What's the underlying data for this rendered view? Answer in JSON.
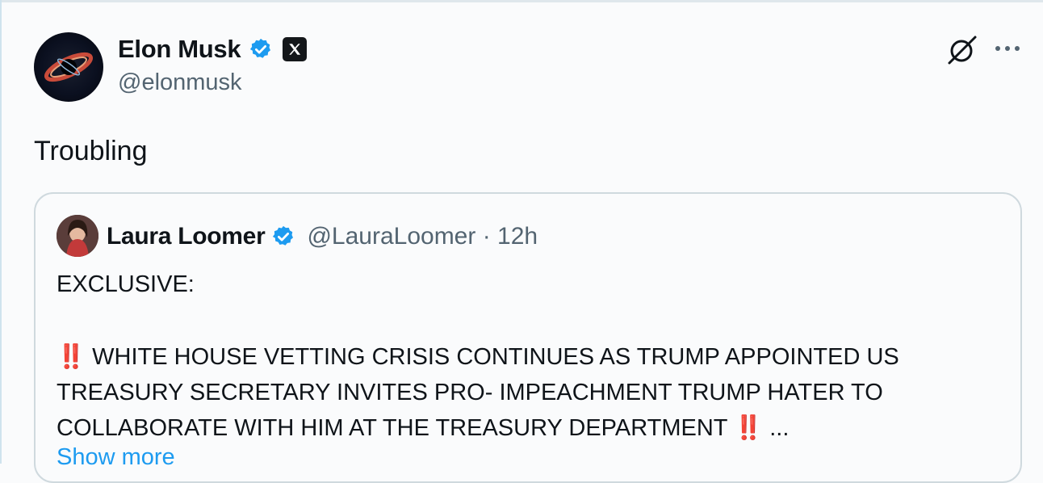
{
  "tweet": {
    "author_name": "Elon Musk",
    "handle": "@elonmusk",
    "text": "Troubling",
    "icons": [
      "verified-badge-icon",
      "x-logo-icon",
      "grok-icon",
      "more-options-icon"
    ]
  },
  "quoted_tweet": {
    "author_name": "Laura Loomer",
    "handle": "@LauraLoomer",
    "separator": "·",
    "time": "12h",
    "heading": "EXCLUSIVE:",
    "emoji_left": "‼️",
    "body": "WHITE HOUSE VETTING CRISIS CONTINUES AS TRUMP APPOINTED US TREASURY SECRETARY INVITES PRO- IMPEACHMENT TRUMP HATER TO COLLABORATE WITH HIM AT THE TREASURY DEPARTMENT",
    "emoji_right": "‼️",
    "ellipsis": "...",
    "show_more": "Show more"
  },
  "colors": {
    "verified_blue": "#1d9bf0",
    "link_blue": "#1d9bf0",
    "muted_text": "#536471",
    "emphasis_red": "#e0245e"
  }
}
